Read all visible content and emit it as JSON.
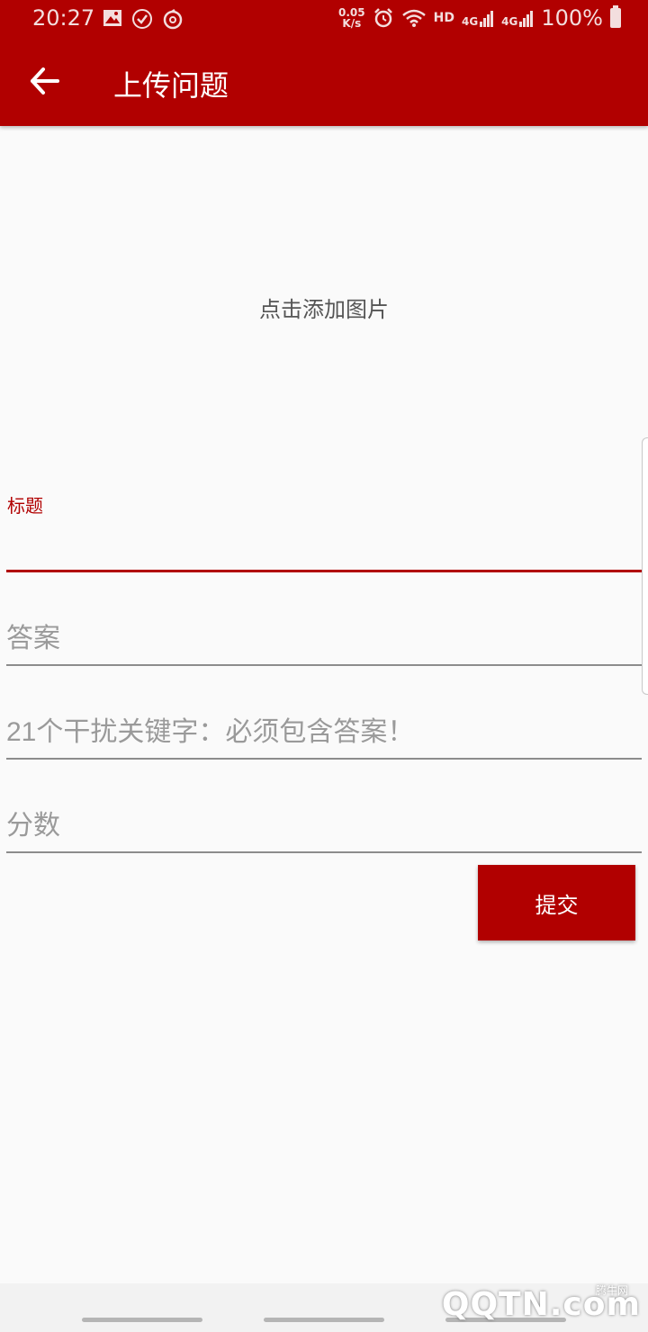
{
  "status_bar": {
    "time": "20:27",
    "net_speed_value": "0.05",
    "net_speed_unit": "K/s",
    "hd_label": "HD",
    "net_type_1": "4G",
    "net_type_2": "4G",
    "battery": "100%"
  },
  "toolbar": {
    "title": "上传问题",
    "accent_color": "#b10000"
  },
  "upload": {
    "label": "点击添加图片"
  },
  "form": {
    "title_label": "标题",
    "title_value": "",
    "answer_placeholder": "答案",
    "keywords_placeholder": "21个干扰关键字：必须包含答案！",
    "score_placeholder": "分数",
    "submit_label": "提交"
  },
  "watermark": {
    "text": "QQTN.com",
    "small_text": "腾牛网"
  }
}
